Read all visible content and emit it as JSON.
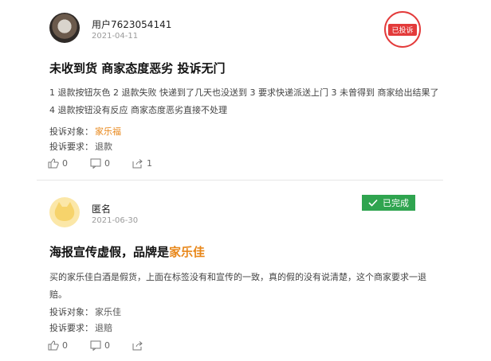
{
  "post1": {
    "user_name": "用户7623054141",
    "date": "2021-04-11",
    "stamp_label": "已投诉",
    "title": "未收到货 商家态度恶劣 投诉无门",
    "body": "1 退款按钮灰色 2 退款失败 快递到了几天也没送到 3 要求快递派送上门 3 未曾得到 商家给出结果了 4 退款按钮没有反应 商家态度恶劣直接不处理",
    "object_label": "投诉对象",
    "object_value": "家乐福",
    "request_label": "投诉要求",
    "request_value": "退款",
    "like_count": "0",
    "comment_count": "0",
    "share_count": "1"
  },
  "post2": {
    "user_name": "匿名",
    "date": "2021-06-30",
    "badge_label": "已完成",
    "title_prefix": "海报宣传虚假，品牌是",
    "title_brand": "家乐佳",
    "body": "买的家乐佳白酒是假货，上面在标签没有和宣传的一致，真的假的没有说清楚，这个商家要求一退赔。",
    "object_label": "投诉对象",
    "object_value": "家乐佳",
    "request_label": "投诉要求",
    "request_value": "退赔",
    "like_count": "0",
    "comment_count": "0",
    "share_count": ""
  },
  "colors": {
    "stamp_red": "#e33b3b",
    "badge_green": "#2fa44f",
    "link_orange": "#e8871a"
  },
  "icons": [
    "like-icon",
    "comment-icon",
    "share-icon",
    "checkmark-icon"
  ]
}
